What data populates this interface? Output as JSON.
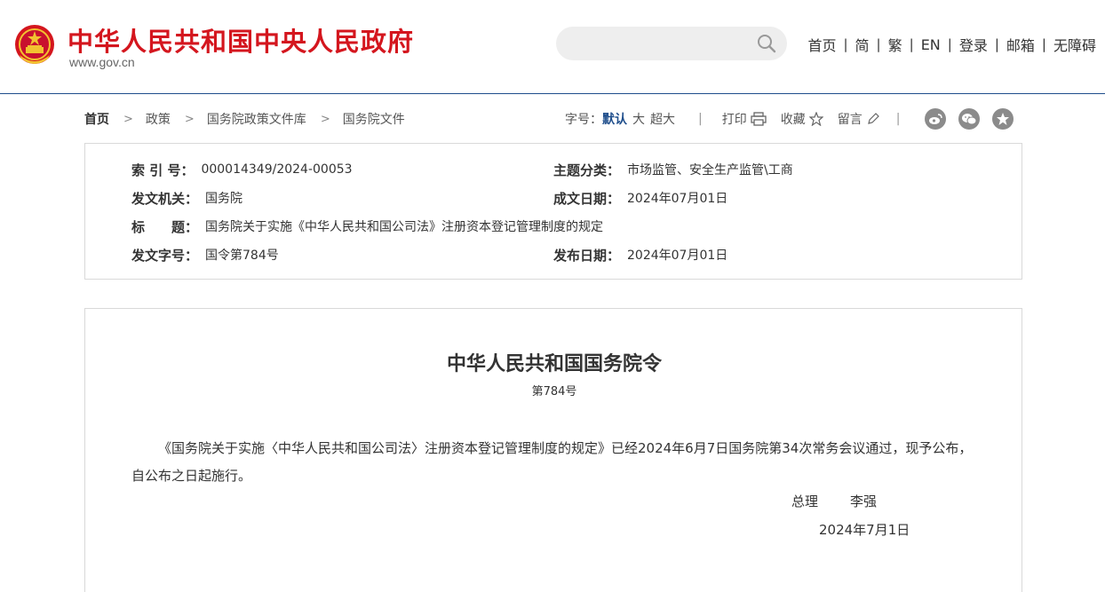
{
  "header": {
    "site_title": "中华人民共和国中央人民政府",
    "site_url": "www.gov.cn",
    "search_placeholder": "",
    "nav": [
      "首页",
      "简",
      "繁",
      "EN",
      "登录",
      "邮箱",
      "无障碍"
    ]
  },
  "breadcrumb": [
    "首页",
    "政策",
    "国务院政策文件库",
    "国务院文件"
  ],
  "tools": {
    "font_size_label": "字号：",
    "font_options": [
      "默认",
      "大",
      "超大"
    ],
    "print_label": "打印",
    "favorite_label": "收藏",
    "comment_label": "留言"
  },
  "meta": {
    "index_label": "索 引 号：",
    "index_value": "000014349/2024-00053",
    "topic_label": "主题分类：",
    "topic_value": "市场监管、安全生产监管\\工商",
    "issuer_label": "发文机关：",
    "issuer_value": "国务院",
    "written_date_label": "成文日期：",
    "written_date_value": "2024年07月01日",
    "title_label": "标　　题：",
    "title_value": "国务院关于实施《中华人民共和国公司法》注册资本登记管理制度的规定",
    "doc_no_label": "发文字号：",
    "doc_no_value": "国令第784号",
    "publish_date_label": "发布日期：",
    "publish_date_value": "2024年07月01日"
  },
  "document": {
    "title": "中华人民共和国国务院令",
    "number": "第784号",
    "body": "《国务院关于实施〈中华人民共和国公司法〉注册资本登记管理制度的规定》已经2024年6月7日国务院第34次常务会议通过，现予公布，自公布之日起施行。",
    "signer_title": "总理",
    "signer_name": "李强",
    "date": "2024年7月1日"
  },
  "colors": {
    "brand_red": "#d4161e",
    "link_blue": "#1f4e8c",
    "icon_gray": "#8b8b8b"
  },
  "icons": [
    "national-emblem-icon",
    "search-icon",
    "chevron-right-icon",
    "printer-icon",
    "star-icon",
    "pencil-icon",
    "weibo-icon",
    "wechat-icon",
    "qzone-icon"
  ]
}
